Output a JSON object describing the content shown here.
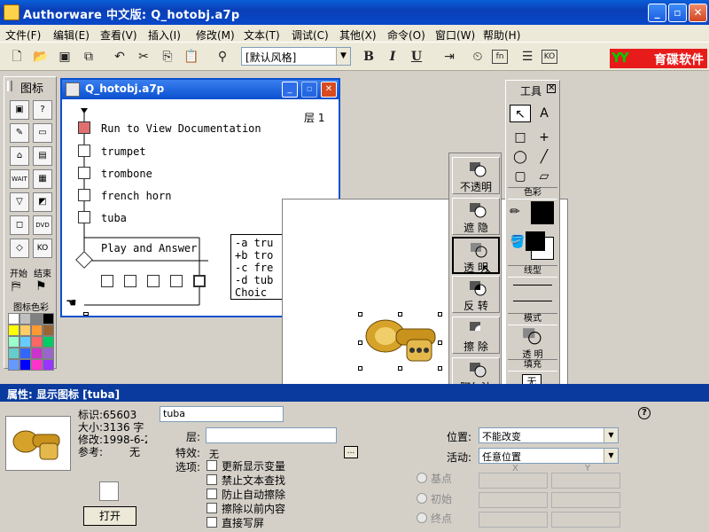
{
  "app": {
    "title": "Authorware 中文版: Q_hotobj.a7p",
    "min": "_",
    "max": "▫",
    "close": "✕"
  },
  "menu": [
    "文件(F)",
    "编辑(E)",
    "查看(V)",
    "插入(I)",
    "修改(M)",
    "文本(T)",
    "调试(C)",
    "其他(X)",
    "命令(O)",
    "窗口(W)",
    "帮助(H)"
  ],
  "toolbar": {
    "style_value": "[默认风格]",
    "bold": "B",
    "italic": "I",
    "underline": "U",
    "logo": "育碟软件",
    "logo_mark": "YY"
  },
  "icon_palette": {
    "title": "图标",
    "start": "开始",
    "end": "结束",
    "color_title": "图标色彩",
    "icons": [
      "display-icon",
      "motion-icon",
      "erase-icon",
      "wait-icon",
      "navigate-icon",
      "framework-icon",
      "decision-icon",
      "interaction-icon",
      "calculation-icon",
      "map-icon",
      "digital-movie-icon",
      "sound-icon",
      "video-icon",
      "knowledge-object-icon"
    ],
    "wait_text": "WAIT",
    "dvd_text": "DVD",
    "ko_text": "KO",
    "colors": [
      "#ffffff",
      "#c0c0c0",
      "#808080",
      "#000000",
      "#ffff00",
      "#ffcc66",
      "#ff9933",
      "#996633",
      "#99ffcc",
      "#66ccff",
      "#ff6666",
      "#00cc66",
      "#66cccc",
      "#3366ff",
      "#cc33cc",
      "#9966cc",
      "#6699ff",
      "#0000ff",
      "#ff33cc",
      "#9933ff"
    ]
  },
  "flowwin": {
    "title": "Q_hotobj.a7p",
    "level": "层 1",
    "items": [
      "Run to View Documentation",
      "trumpet",
      "trombone",
      "french horn",
      "tuba"
    ],
    "interaction": "Play and Answer",
    "responses": [
      "-a tru",
      "+b tro",
      "-c fre",
      "-d tub",
      " Choic"
    ]
  },
  "modes": [
    "不透明",
    "遮  隐",
    "透  明",
    "反  转",
    "擦  除",
    "阿尔法"
  ],
  "tools": {
    "title": "工具",
    "color_label": "色彩",
    "line_label": "线型",
    "mode_label": "模式",
    "mode_value": "透  明",
    "fill_label": "填充",
    "fill_value": "无",
    "text_tool": "A",
    "pointer": "↖"
  },
  "properties": {
    "header": "属性: 显示图标 [tuba]",
    "id_label": "标识:65603",
    "size_label": "大小:3136 字",
    "modified_label": "修改:1998-6-2",
    "ref_label": "参考:",
    "ref_value": "无",
    "name_value": "tuba",
    "layer_label": "层:",
    "effect_label": "特效:",
    "effect_value": "无",
    "effect_btn": "...",
    "options_label": "选项:",
    "options": [
      "更新显示变量",
      "禁止文本查找",
      "防止自动擦除",
      "擦除以前内容",
      "直接写屏"
    ],
    "open_btn": "打开",
    "position_label": "位置:",
    "position_value": "不能改变",
    "movable_label": "活动:",
    "movable_value": "任意位置",
    "radios": [
      "基点",
      "初始",
      "终点"
    ],
    "x_label": "X",
    "y_label": "Y",
    "help": "?"
  }
}
